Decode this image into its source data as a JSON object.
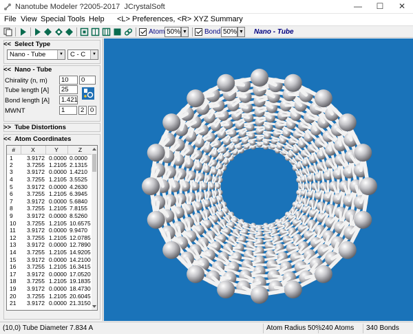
{
  "window": {
    "title": "Nanotube Modeler ?2005-2017  JCrystalSoft",
    "controls": [
      "—",
      "☐",
      "✕"
    ]
  },
  "menu": {
    "items": [
      "File",
      "View",
      "Special",
      "Tools",
      "Help"
    ],
    "hint": "<L> Preferences, <R> XYZ Summary"
  },
  "toolbar": {
    "atoms_label": "Atoms",
    "atoms_value": "50%",
    "bonds_label": "Bonds",
    "bonds_value": "50%",
    "mode": "Nano - Tube"
  },
  "panel": {
    "select_type": {
      "header": "Select Type",
      "type_value": "Nano - Tube",
      "bond_value": "C - C"
    },
    "nanotube": {
      "header": "Nano - Tube",
      "chirality_label": "Chirality  (n, m)",
      "chirality_n": "10",
      "chirality_m": "0",
      "tube_length_label": "Tube length [A]",
      "tube_length_value": "25",
      "bond_length_label": "Bond length [A]",
      "bond_length_value": "1.421",
      "mwnt_label": "MWNT",
      "mwnt_1": "1",
      "mwnt_2": "2",
      "mwnt_3": "0"
    },
    "distortions_header": "Tube Distortions",
    "coords_header": "Atom Coordinates",
    "coords_columns": [
      "#",
      "X",
      "Y",
      "Z"
    ],
    "coords_rows": [
      [
        "1",
        "3.9172",
        "0.0000",
        "0.0000"
      ],
      [
        "2",
        "3.7255",
        "1.2105",
        "2.1315"
      ],
      [
        "3",
        "3.9172",
        "0.0000",
        "1.4210"
      ],
      [
        "4",
        "3.7255",
        "1.2105",
        "3.5525"
      ],
      [
        "5",
        "3.9172",
        "0.0000",
        "4.2630"
      ],
      [
        "6",
        "3.7255",
        "1.2105",
        "6.3945"
      ],
      [
        "7",
        "3.9172",
        "0.0000",
        "5.6840"
      ],
      [
        "8",
        "3.7255",
        "1.2105",
        "7.8155"
      ],
      [
        "9",
        "3.9172",
        "0.0000",
        "8.5260"
      ],
      [
        "10",
        "3.7255",
        "1.2105",
        "10.6575"
      ],
      [
        "11",
        "3.9172",
        "0.0000",
        "9.9470"
      ],
      [
        "12",
        "3.7255",
        "1.2105",
        "12.0785"
      ],
      [
        "13",
        "3.9172",
        "0.0000",
        "12.7890"
      ],
      [
        "14",
        "3.7255",
        "1.2105",
        "14.9205"
      ],
      [
        "15",
        "3.9172",
        "0.0000",
        "14.2100"
      ],
      [
        "16",
        "3.7255",
        "1.2105",
        "16.3415"
      ],
      [
        "17",
        "3.9172",
        "0.0000",
        "17.0520"
      ],
      [
        "18",
        "3.7255",
        "1.2105",
        "19.1835"
      ],
      [
        "19",
        "3.9172",
        "0.0000",
        "18.4730"
      ],
      [
        "20",
        "3.7255",
        "1.2105",
        "20.6045"
      ],
      [
        "21",
        "3.9172",
        "0.0000",
        "21.3150"
      ]
    ]
  },
  "status": {
    "diameter": "(10,0) Tube Diameter 7.834 A",
    "atom_radius": "Atom Radius 50%",
    "atoms": "240 Atoms",
    "bonds": "340 Bonds"
  },
  "colors": {
    "viewport_bg": "#1a73b9",
    "atom": "#d0d0d4",
    "bond": "#f2f2f2",
    "mode_text": "#000080"
  }
}
